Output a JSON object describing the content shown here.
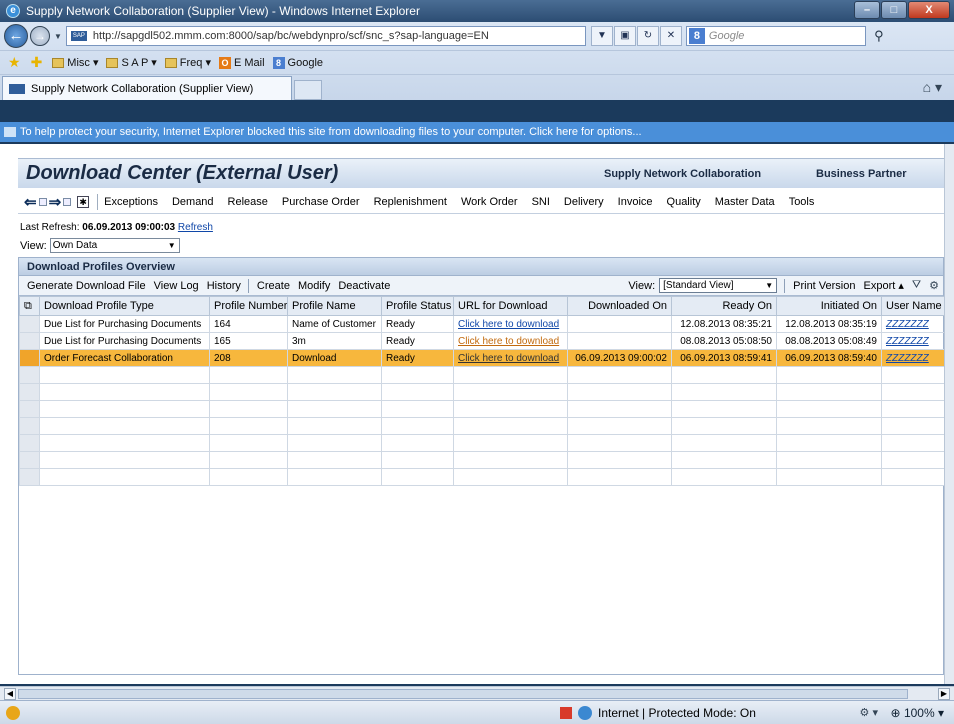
{
  "window": {
    "title": "Supply Network Collaboration (Supplier View) - Windows Internet Explorer",
    "min": "–",
    "max": "□",
    "close": "X"
  },
  "browser": {
    "address": "http://sapgdl502.mmm.com:8000/sap/bc/webdynpro/scf/snc_s?sap-language=EN",
    "search_placeholder": "Google",
    "favorites": [
      "Misc ▾",
      "S A P ▾",
      "Freq ▾",
      "E Mail",
      "Google"
    ],
    "tab_title": "Supply Network Collaboration (Supplier View)",
    "infobar": "To help protect your security, Internet Explorer blocked this site from downloading files to your computer. Click here for options..."
  },
  "header": {
    "title": "Download Center (External User)",
    "link_snc": "Supply Network Collaboration",
    "link_bp": "Business Partner"
  },
  "menu": [
    "Exceptions",
    "Demand",
    "Release",
    "Purchase Order",
    "Replenishment",
    "Work Order",
    "SNI",
    "Delivery",
    "Invoice",
    "Quality",
    "Master Data",
    "Tools"
  ],
  "refresh": {
    "label": "Last Refresh:",
    "timestamp": "06.09.2013 09:00:03",
    "link": "Refresh"
  },
  "view": {
    "label": "View:",
    "value": "Own Data"
  },
  "panel": {
    "title": "Download Profiles Overview",
    "toolbar": [
      "Generate Download File",
      "View Log",
      "History",
      "Create",
      "Modify",
      "Deactivate"
    ],
    "view_label": "View:",
    "view_value": "[Standard View]",
    "print_version": "Print Version",
    "export": "Export ▴"
  },
  "table": {
    "columns": [
      "Download Profile Type",
      "Profile Number",
      "Profile Name",
      "Profile Status",
      "URL for Download",
      "Downloaded On",
      "Ready On",
      "Initiated On",
      "User Name"
    ],
    "rows": [
      {
        "type": "Due List for Purchasing Documents",
        "number": "164",
        "name": "Name of Customer",
        "status": "Ready",
        "url": "Click here to download",
        "downloaded": "",
        "ready": "12.08.2013 08:35:21",
        "initiated": "12.08.2013 08:35:19",
        "user": "ZZZZZZZ"
      },
      {
        "type": "Due List for Purchasing Documents",
        "number": "165",
        "name": "3m",
        "status": "Ready",
        "url": "Click here to download",
        "downloaded": "",
        "ready": "08.08.2013 05:08:50",
        "initiated": "08.08.2013 05:08:49",
        "user": "ZZZZZZZ"
      },
      {
        "type": "Order Forecast Collaboration",
        "number": "208",
        "name": "Download",
        "status": "Ready",
        "url": "Click here to download",
        "downloaded": "06.09.2013 09:00:02",
        "ready": "06.09.2013 08:59:41",
        "initiated": "06.09.2013 08:59:40",
        "user": "ZZZZZZZ"
      }
    ]
  },
  "status": {
    "zone": "Internet | Protected Mode: On",
    "zoom": "100%"
  },
  "colors": {
    "highlight_row": "#f7b73d",
    "infobar": "#4a8fd9",
    "link": "#1047a8"
  }
}
